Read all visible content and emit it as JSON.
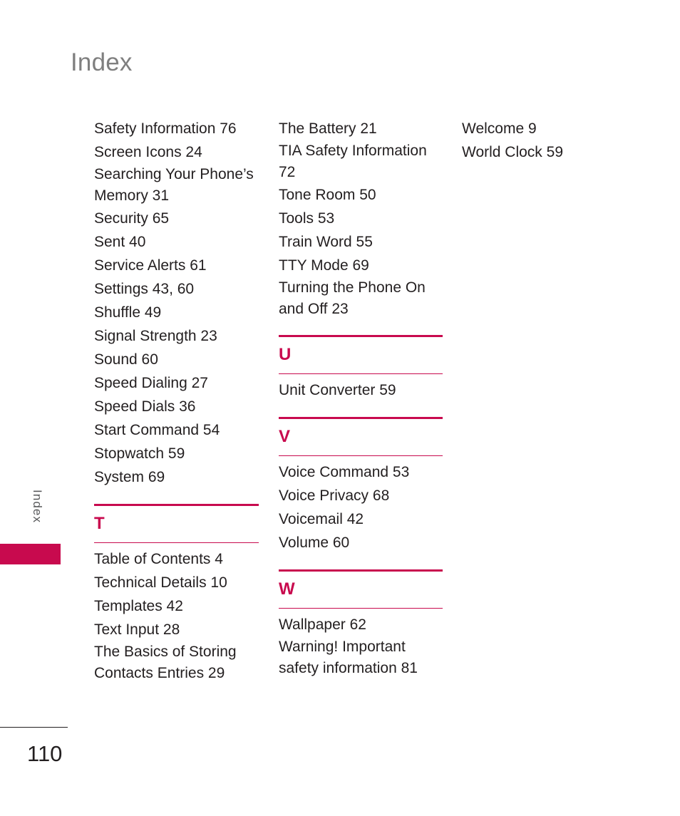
{
  "page": {
    "title": "Index",
    "number": "110",
    "side_tab_label": "Index",
    "accent_color": "#c80a4e",
    "text_color": "#231f20",
    "title_color": "#7f7f7f"
  },
  "columns": [
    {
      "name": "column-1",
      "blocks": [
        {
          "type": "entries",
          "items": [
            "Safety Information 76",
            "Screen Icons 24",
            "Searching Your Phone’s Memory 31",
            "Security 65",
            "Sent 40",
            "Service Alerts 61",
            "Settings 43, 60",
            "Shuffle 49",
            "Signal Strength 23",
            "Sound 60",
            "Speed Dialing 27",
            "Speed Dials 36",
            "Start Command 54",
            "Stopwatch 59",
            "System 69"
          ]
        },
        {
          "type": "section",
          "letter": "T",
          "items": [
            "Table of Contents 4",
            "Technical Details 10",
            "Templates 42",
            "Text Input 28",
            "The Basics of Storing Contacts Entries 29"
          ]
        }
      ]
    },
    {
      "name": "column-2",
      "blocks": [
        {
          "type": "entries",
          "items": [
            "The Battery 21",
            "TIA Safety Information 72",
            "Tone Room 50",
            "Tools 53",
            "Train Word 55",
            "TTY Mode 69",
            "Turning the Phone On and Off 23"
          ]
        },
        {
          "type": "section",
          "letter": "U",
          "items": [
            "Unit Converter 59"
          ]
        },
        {
          "type": "section",
          "letter": "V",
          "items": [
            "Voice Command 53",
            "Voice Privacy 68",
            "Voicemail 42",
            "Volume 60"
          ]
        },
        {
          "type": "section",
          "letter": "W",
          "items": [
            "Wallpaper 62",
            "Warning! Important safety information 81"
          ]
        }
      ]
    },
    {
      "name": "column-3",
      "blocks": [
        {
          "type": "entries",
          "items": [
            "Welcome 9",
            "World Clock 59"
          ]
        }
      ]
    }
  ]
}
